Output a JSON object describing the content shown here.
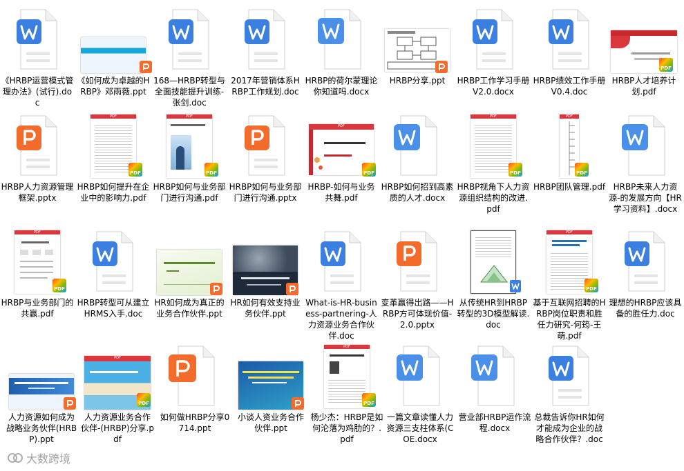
{
  "files": [
    {
      "name": "《HRBP运营模式管理办法》(试行).doc",
      "type": "doc"
    },
    {
      "name": "《如何成为卓越的HRBP》邓雨薇.ppt",
      "type": "ppt-banner"
    },
    {
      "name": "168—HRBP转型与全面技能提升训练-张剑.doc",
      "type": "doc"
    },
    {
      "name": "2017年营销体系HRBP工作规划.doc",
      "type": "doc"
    },
    {
      "name": "HRBP的荷尔蒙理论你知道吗.docx",
      "type": "docx"
    },
    {
      "name": "HRBP分享.ppt",
      "type": "ppt-diagram"
    },
    {
      "name": "HRBP工作学习手册V2.0.docx",
      "type": "doc"
    },
    {
      "name": "HRBP绩效工作手册V0.4.doc",
      "type": "doc"
    },
    {
      "name": "HRBP人才培养计划.pdf",
      "type": "pdf-slide"
    },
    {
      "name": "HRBP人力资源管理框架.pptx",
      "type": "pptx"
    },
    {
      "name": "HRBP如何提升在企业中的影响力.pdf",
      "type": "pdf-text"
    },
    {
      "name": "HRBP如何与业务部门进行沟通.pdf",
      "type": "pdf-photo"
    },
    {
      "name": "HRBP如何与业务部门进行沟通.pptx",
      "type": "pptx"
    },
    {
      "name": "HRBP-如何与业务共舞.pdf",
      "type": "pdf-slide2"
    },
    {
      "name": "HRBP如何招到高素质的人才.docx",
      "type": "docx"
    },
    {
      "name": "HRBP视角下人力资源组织结构的改进.pdf",
      "type": "pdf-text"
    },
    {
      "name": "HRBP团队管理.pdf",
      "type": "pdf-tree"
    },
    {
      "name": "HRBP未来人力资源-的发展方向【HR学习资料】.docx",
      "type": "docx"
    },
    {
      "name": "HRBP与业务部门的共赢.pdf",
      "type": "pdf-chart"
    },
    {
      "name": "HRBP转型可从建立HRMS入手.doc",
      "type": "doc"
    },
    {
      "name": "HR如何成为真正的业务合作伙伴.ppt",
      "type": "ppt-green"
    },
    {
      "name": "HR如何有效支持业务伙伴.ppt",
      "type": "ppt-dark"
    },
    {
      "name": "What-is-HR-business-partnering-人力资源业务合作伙伴.doc",
      "type": "doc"
    },
    {
      "name": "变革赢得出路——HRBP方可体现价值-2.0.pptx",
      "type": "pptx"
    },
    {
      "name": "从传统HR到HRBP转型的3D模型解读.doc",
      "type": "doc-page"
    },
    {
      "name": "基于互联网招聘的HRBP岗位职责和胜任力研究-何筠-王萌.pdf",
      "type": "pdf-text"
    },
    {
      "name": "理想的HRBP应该具备的胜任力.doc",
      "type": "doc"
    },
    {
      "name": "人力资源如何成为战略业务伙伴(HRBP).ppt",
      "type": "ppt-blue"
    },
    {
      "name": "人力资源业务合作伙伴-(HRBP)分享.pdf",
      "type": "pdf-beach"
    },
    {
      "name": "如何做HRBP分享0714.ppt",
      "type": "ppt-big"
    },
    {
      "name": "小谈人资业务合作伙伴.ppt",
      "type": "ppt-bluegreen"
    },
    {
      "name": "杨少杰：HRBP是如何沦落为鸡肋的？.pdf",
      "type": "pdf-text2"
    },
    {
      "name": "一篇文章读懂人力资源三支柱体系(COE.docx",
      "type": "docx"
    },
    {
      "name": "营业部HRBP运作流程.docx",
      "type": "docx"
    },
    {
      "name": "总裁告诉你HR如何才能成为企业的战略合作伙伴？.doc",
      "type": "doc"
    }
  ],
  "badges": {
    "pdf": "PDF"
  },
  "watermark": {
    "text": "大数跨境"
  }
}
